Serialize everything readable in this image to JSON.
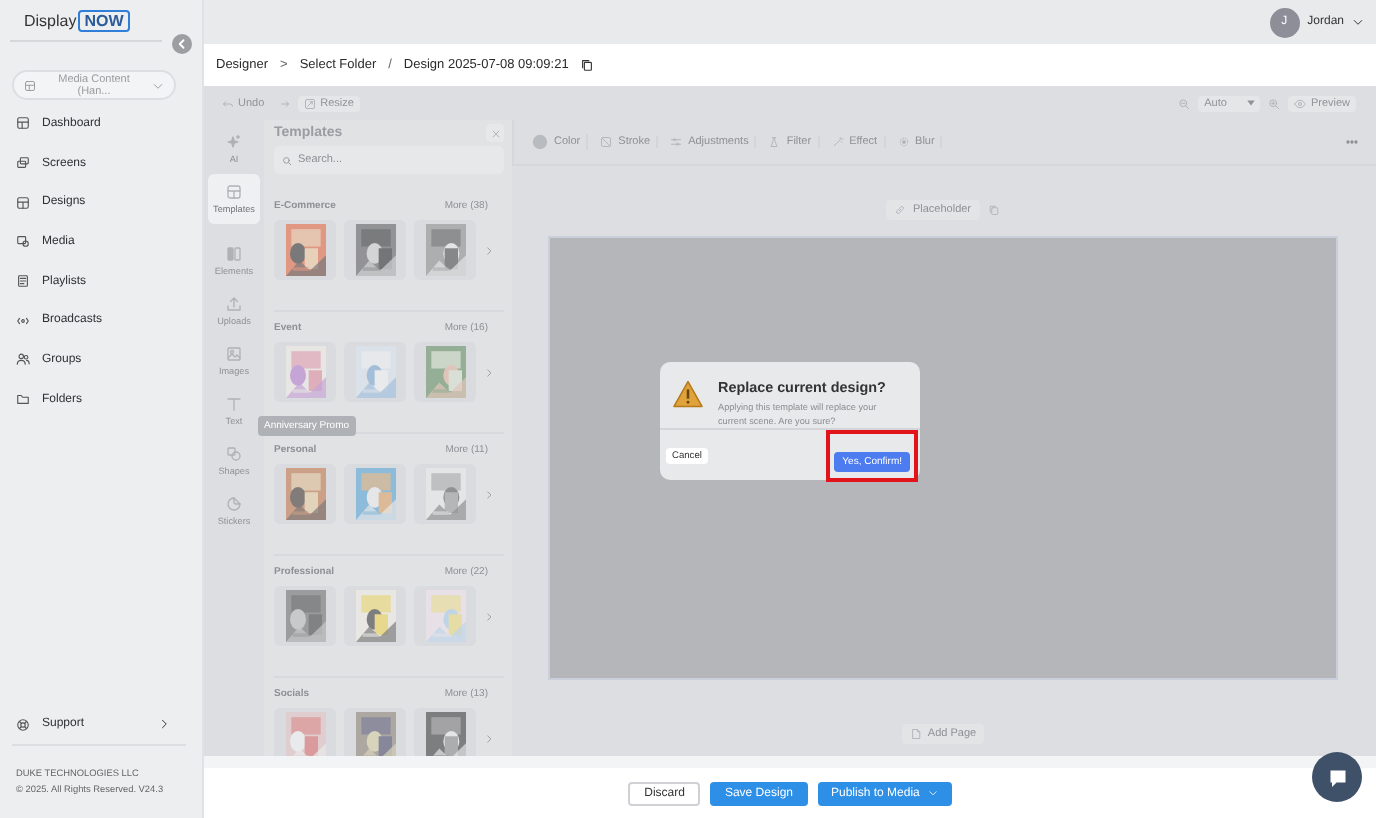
{
  "brand": {
    "name": "Display",
    "badge": "NOW"
  },
  "workspace": {
    "label": "Media Content (Han..."
  },
  "nav": [
    {
      "label": "Dashboard"
    },
    {
      "label": "Screens"
    },
    {
      "label": "Designs"
    },
    {
      "label": "Media"
    },
    {
      "label": "Playlists"
    },
    {
      "label": "Broadcasts"
    },
    {
      "label": "Groups"
    },
    {
      "label": "Folders"
    }
  ],
  "support": {
    "label": "Support"
  },
  "footer": [
    "DUKE TECHNOLOGIES LLC",
    "© 2025. All Rights Reserved. V24.3"
  ],
  "user": {
    "initial": "J",
    "name": "Jordan"
  },
  "breadcrumb": {
    "items": [
      "Designer",
      "Select Folder",
      "Design 2025-07-08 09:09:21"
    ],
    "separators": [
      ">",
      "/"
    ]
  },
  "toolbar": {
    "undo": "Undo",
    "resize": "Resize",
    "zoom": "Auto",
    "preview": "Preview"
  },
  "rail": [
    {
      "label": "AI",
      "selected": false
    },
    {
      "label": "Templates",
      "selected": true
    },
    {
      "label": "Elements",
      "selected": false
    },
    {
      "label": "Uploads",
      "selected": false
    },
    {
      "label": "Images",
      "selected": false
    },
    {
      "label": "Text",
      "selected": false
    },
    {
      "label": "Shapes",
      "selected": false
    },
    {
      "label": "Stickers",
      "selected": false
    }
  ],
  "templates": {
    "title": "Templates",
    "placeholder": "Search...",
    "tooltip": "Anniversary Promo",
    "sections": [
      {
        "title": "E-Commerce",
        "more": "More (38)"
      },
      {
        "title": "Event",
        "more": "More (16)"
      },
      {
        "title": "Personal",
        "more": "More (11)"
      },
      {
        "title": "Professional",
        "more": "More (22)"
      },
      {
        "title": "Socials",
        "more": "More (13)"
      }
    ]
  },
  "properties": [
    {
      "label": "Color"
    },
    {
      "label": "Stroke"
    },
    {
      "label": "Adjustments"
    },
    {
      "label": "Filter"
    },
    {
      "label": "Effect"
    },
    {
      "label": "Blur"
    }
  ],
  "placeholder_chip": "Placeholder",
  "add_page": "Add Page",
  "dialog": {
    "title": "Replace current design?",
    "message": "Applying this template will replace your current scene. Are you sure?",
    "cancel": "Cancel",
    "confirm": "Yes, Confirm!",
    "highlighted": true
  },
  "actions": [
    {
      "label": "Discard",
      "kind": "secondary",
      "dropdown": false
    },
    {
      "label": "Save Design",
      "kind": "primary",
      "dropdown": false
    },
    {
      "label": "Publish to Media",
      "kind": "primary",
      "dropdown": true
    }
  ]
}
